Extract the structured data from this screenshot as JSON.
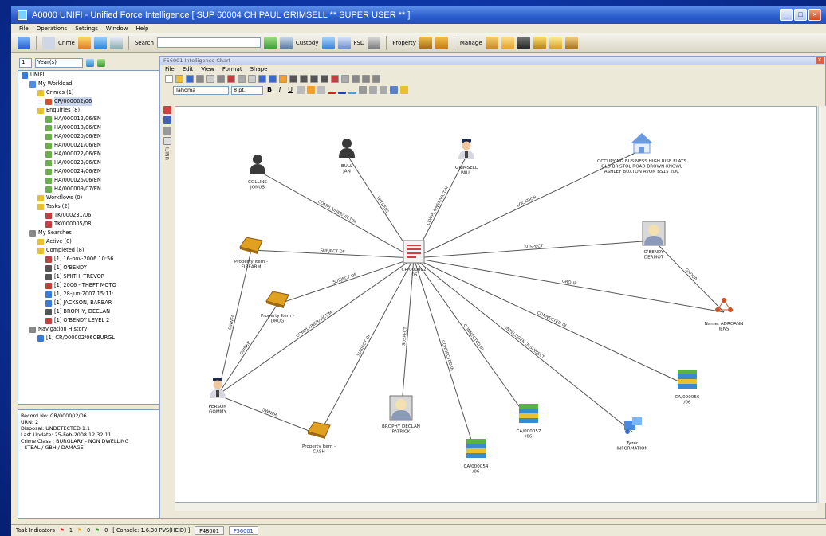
{
  "window": {
    "title": "A0000 UNIFI - Unified Force Intelligence  [ SUP  60004  CH   PAUL  GRIMSELL ** SUPER USER ** ]",
    "buttons": [
      "_",
      "□",
      "×"
    ]
  },
  "menubar": [
    "File",
    "Operations",
    "Settings",
    "Window",
    "Help"
  ],
  "toolbar": {
    "crime_label": "Crime",
    "search_label": "Search",
    "custody_label": "Custody",
    "fsd_label": "FSD",
    "property_label": "Property",
    "manage_label": "Manage"
  },
  "leftpane": {
    "year_value": "Year(s)",
    "year_count": "1",
    "tree": [
      {
        "level": 0,
        "label": "UNIFI",
        "icon": "unifi-icon",
        "color": "#3a7bd5"
      },
      {
        "level": 1,
        "label": "My Workload",
        "icon": "folder-icon",
        "color": "#4a8fe0"
      },
      {
        "level": 2,
        "label": "Crimes (1)",
        "icon": "folder-icon",
        "color": "#e8c030"
      },
      {
        "level": 3,
        "label": "CR/000002/06",
        "icon": "crime-icon",
        "color": "#d05030",
        "selected": true
      },
      {
        "level": 2,
        "label": "Enquiries (8)",
        "icon": "folder-icon",
        "color": "#e8c030"
      },
      {
        "level": 3,
        "label": "HA/000012/06/EN",
        "icon": "enquiry-icon",
        "color": "#6ab04a"
      },
      {
        "level": 3,
        "label": "HA/000018/06/EN",
        "icon": "enquiry-icon",
        "color": "#6ab04a"
      },
      {
        "level": 3,
        "label": "HA/000020/06/EN",
        "icon": "enquiry-icon",
        "color": "#6ab04a"
      },
      {
        "level": 3,
        "label": "HA/000021/06/EN",
        "icon": "enquiry-icon",
        "color": "#6ab04a"
      },
      {
        "level": 3,
        "label": "HA/000022/06/EN",
        "icon": "enquiry-icon",
        "color": "#6ab04a"
      },
      {
        "level": 3,
        "label": "HA/000023/06/EN",
        "icon": "enquiry-icon",
        "color": "#6ab04a"
      },
      {
        "level": 3,
        "label": "HA/000024/06/EN",
        "icon": "enquiry-icon",
        "color": "#6ab04a"
      },
      {
        "level": 3,
        "label": "HA/000026/06/EN",
        "icon": "enquiry-icon",
        "color": "#6ab04a"
      },
      {
        "level": 3,
        "label": "HA/000009/07/EN",
        "icon": "enquiry-icon",
        "color": "#6ab04a"
      },
      {
        "level": 2,
        "label": "Workflows (0)",
        "icon": "folder-icon",
        "color": "#e8c030"
      },
      {
        "level": 2,
        "label": "Tasks (2)",
        "icon": "folder-icon",
        "color": "#e8c030"
      },
      {
        "level": 3,
        "label": "TK/000231/06",
        "icon": "task-icon",
        "color": "#c04040"
      },
      {
        "level": 3,
        "label": "TK/000005/08",
        "icon": "task-icon",
        "color": "#c04040"
      },
      {
        "level": 1,
        "label": "My Searches",
        "icon": "search-folder-icon",
        "color": "#888"
      },
      {
        "level": 2,
        "label": "Active (0)",
        "icon": "folder-icon",
        "color": "#e8c030"
      },
      {
        "level": 2,
        "label": "Completed (8)",
        "icon": "folder-icon",
        "color": "#e8c030"
      },
      {
        "level": 3,
        "label": "[1] 16-nov-2006 10:56",
        "icon": "search-result-icon",
        "color": "#c04040"
      },
      {
        "level": 3,
        "label": "[1] O'BENDY",
        "icon": "person-icon",
        "color": "#555"
      },
      {
        "level": 3,
        "label": "[1] SMITH, TREVOR",
        "icon": "person-icon",
        "color": "#555"
      },
      {
        "level": 3,
        "label": "[1] 2006 - THEFT MOTO",
        "icon": "search-result-icon",
        "color": "#c04040"
      },
      {
        "level": 3,
        "label": "[1] 28-jun-2007 15:11:",
        "icon": "search-result-icon",
        "color": "#3a7bd5"
      },
      {
        "level": 3,
        "label": "[1] JACKSON, BARBAR",
        "icon": "person-icon",
        "color": "#3a7bd5"
      },
      {
        "level": 3,
        "label": "[1] BROPHY, DECLAN",
        "icon": "person-icon",
        "color": "#555"
      },
      {
        "level": 3,
        "label": "[1] O'BENDY LEVEL 2",
        "icon": "person-icon",
        "color": "#c04040"
      },
      {
        "level": 1,
        "label": "Navigation History",
        "icon": "history-icon",
        "color": "#888"
      },
      {
        "level": 2,
        "label": "[1] CR/000002/06CBURGL",
        "icon": "history-item-icon",
        "color": "#3a7bd5"
      }
    ],
    "record": [
      "Record No: CR/000002/06",
      "URN:        2",
      "Disposal: UNDETECTED 1.1",
      "Last Update: 25-Feb-2008 12:32:11",
      "Crime Class : BURGLARY - NON DWELLING",
      "- STEAL / GBH / DAMAGE"
    ]
  },
  "chart_window": {
    "title": "F56001 Intelligence Chart",
    "menu": [
      "File",
      "Edit",
      "View",
      "Format",
      "Shape"
    ],
    "font_value": "Tahoma",
    "size_value": "8 pt."
  },
  "chart": {
    "nodes": [
      {
        "id": "crime",
        "label": "CR/000002\n/06",
        "icon": "crime-record-icon"
      },
      {
        "id": "collins",
        "label": "COLLINS\nJONUS",
        "icon": "person-icon"
      },
      {
        "id": "bull",
        "label": "BULL\nJAN",
        "icon": "person-icon"
      },
      {
        "id": "grimsell",
        "label": "GRIMSELL\nPAUL",
        "icon": "police-officer-icon"
      },
      {
        "id": "location",
        "label": "OCCUPYING BUSINESS  HIGH RISE FLATS\nOLD BRISTOL ROAD  BROWN KNOWL\nASHLEY  BUXTON  AVON  BS15 2DC",
        "icon": "house-icon"
      },
      {
        "id": "obendy",
        "label": "O'BENDY\nDERMOT",
        "icon": "person-photo-icon"
      },
      {
        "id": "group",
        "label": "Name: ADROANN\nIENS",
        "icon": "group-icon"
      },
      {
        "id": "prop_firearm",
        "label": "Property Item -\nFIREARM",
        "icon": "property-icon"
      },
      {
        "id": "prop_drug",
        "label": "Property Item -\nDRUG",
        "icon": "property-icon"
      },
      {
        "id": "gommy",
        "label": "PERSON\nGOMMY",
        "icon": "police-officer-icon"
      },
      {
        "id": "prop_cash",
        "label": "Property Item -\nCASH",
        "icon": "property-icon"
      },
      {
        "id": "brophy",
        "label": "BROPHY DECLAN\nPATRICK",
        "icon": "person-photo-icon"
      },
      {
        "id": "ca54",
        "label": "CA/000054\n/06",
        "icon": "case-stack-icon"
      },
      {
        "id": "ca57",
        "label": "CA/000057\n/06",
        "icon": "case-stack-icon"
      },
      {
        "id": "tyzer",
        "label": "Tyzer\nINFORMATION",
        "icon": "information-icon"
      },
      {
        "id": "ca56",
        "label": "CA/000056\n/06",
        "icon": "case-stack-icon"
      }
    ],
    "edges": [
      {
        "from": "crime",
        "to": "collins",
        "label": "COMPLAINER/VICTIM"
      },
      {
        "from": "crime",
        "to": "bull",
        "label": "WITNESS"
      },
      {
        "from": "crime",
        "to": "grimsell",
        "label": "COMPLAINER/VICTIM"
      },
      {
        "from": "crime",
        "to": "location",
        "label": "LOCATION"
      },
      {
        "from": "crime",
        "to": "obendy",
        "label": "SUSPECT"
      },
      {
        "from": "crime",
        "to": "group",
        "label": "GROUP"
      },
      {
        "from": "crime",
        "to": "prop_firearm",
        "label": "SUBJECT OF"
      },
      {
        "from": "crime",
        "to": "prop_drug",
        "label": "SUBJECT OF"
      },
      {
        "from": "crime",
        "to": "gommy",
        "label": "COMPLAINER/VICTIM"
      },
      {
        "from": "crime",
        "to": "prop_cash",
        "label": "SUBJECT OF"
      },
      {
        "from": "crime",
        "to": "brophy",
        "label": "SUSPECT"
      },
      {
        "from": "crime",
        "to": "ca54",
        "label": "CONNECTED IN"
      },
      {
        "from": "crime",
        "to": "ca57",
        "label": "CONNECTED IN"
      },
      {
        "from": "crime",
        "to": "tyzer",
        "label": "INTELLIGENCE SUBJECT"
      },
      {
        "from": "crime",
        "to": "ca56",
        "label": "CONNECTED IN"
      },
      {
        "from": "obendy",
        "to": "group",
        "label": "GROUP"
      },
      {
        "from": "gommy",
        "to": "prop_firearm",
        "label": "OWNER"
      },
      {
        "from": "gommy",
        "to": "prop_drug",
        "label": "OWNER"
      },
      {
        "from": "gommy",
        "to": "prop_cash",
        "label": "OWNER"
      }
    ]
  },
  "statusbar": {
    "label": "Task Indicators",
    "counts": [
      "1",
      "0",
      "0"
    ],
    "console": "[ Console: 1.6.30 PVS(HEID) ]",
    "tabs": [
      "F48001",
      "F56001"
    ]
  }
}
